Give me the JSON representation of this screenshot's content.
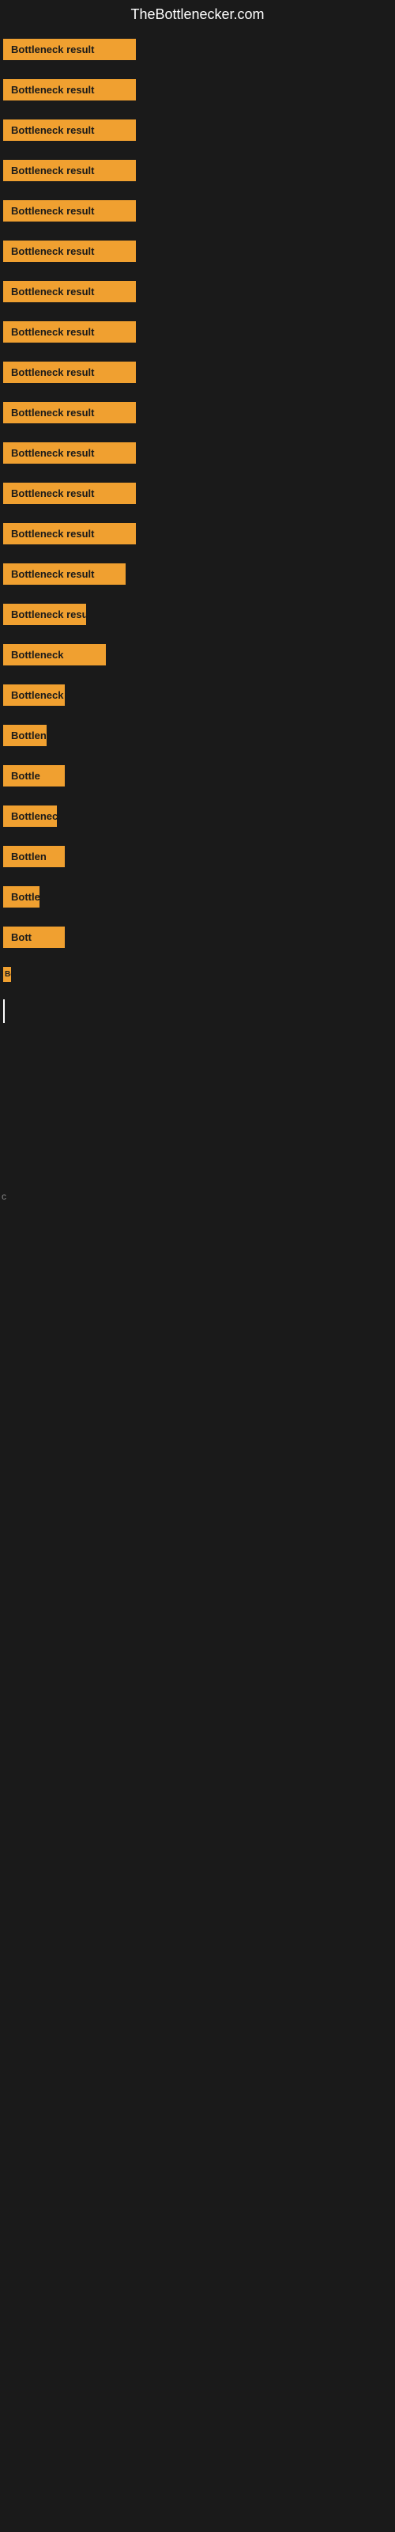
{
  "site": {
    "title": "TheBottlenecker.com"
  },
  "rows": [
    {
      "id": 1,
      "label": "Bottleneck result",
      "width_class": "badge-w-1"
    },
    {
      "id": 2,
      "label": "Bottleneck result",
      "width_class": "badge-w-2"
    },
    {
      "id": 3,
      "label": "Bottleneck result",
      "width_class": "badge-w-3"
    },
    {
      "id": 4,
      "label": "Bottleneck result",
      "width_class": "badge-w-4"
    },
    {
      "id": 5,
      "label": "Bottleneck result",
      "width_class": "badge-w-5"
    },
    {
      "id": 6,
      "label": "Bottleneck result",
      "width_class": "badge-w-6"
    },
    {
      "id": 7,
      "label": "Bottleneck result",
      "width_class": "badge-w-7"
    },
    {
      "id": 8,
      "label": "Bottleneck result",
      "width_class": "badge-w-8"
    },
    {
      "id": 9,
      "label": "Bottleneck result",
      "width_class": "badge-w-9"
    },
    {
      "id": 10,
      "label": "Bottleneck result",
      "width_class": "badge-w-10"
    },
    {
      "id": 11,
      "label": "Bottleneck result",
      "width_class": "badge-w-11"
    },
    {
      "id": 12,
      "label": "Bottleneck result",
      "width_class": "badge-w-12"
    },
    {
      "id": 13,
      "label": "Bottleneck result",
      "width_class": "badge-w-13"
    },
    {
      "id": 14,
      "label": "Bottleneck result",
      "width_class": "badge-w-14"
    },
    {
      "id": 15,
      "label": "Bottleneck resu",
      "width_class": "badge-w-15"
    },
    {
      "id": 16,
      "label": "Bottleneck",
      "width_class": "badge-w-16"
    },
    {
      "id": 17,
      "label": "Bottleneck re",
      "width_class": "badge-w-17"
    },
    {
      "id": 18,
      "label": "Bottlenec",
      "width_class": "badge-w-18"
    },
    {
      "id": 19,
      "label": "Bottle",
      "width_class": "badge-w-19"
    },
    {
      "id": 20,
      "label": "Bottlenec",
      "width_class": "badge-w-20"
    },
    {
      "id": 21,
      "label": "Bottlen",
      "width_class": "badge-w-21"
    },
    {
      "id": 22,
      "label": "Bottleneck",
      "width_class": "badge-w-22"
    },
    {
      "id": 23,
      "label": "Bott",
      "width_class": "badge-w-23"
    },
    {
      "id": 24,
      "label": "Bottlenec",
      "width_class": "badge-w-24"
    }
  ],
  "cursor_visible": true,
  "bottom_char": "c"
}
